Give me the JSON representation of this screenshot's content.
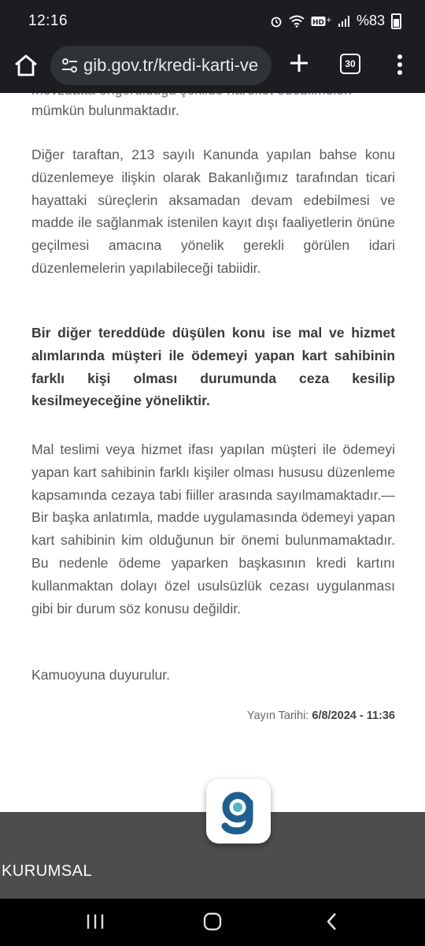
{
  "status_bar": {
    "time": "12:16",
    "battery": "%83"
  },
  "address_bar": {
    "url": "gib.gov.tr/kredi-karti-ve",
    "tab_count": "30"
  },
  "article": {
    "partial_top_line": "mevzuatta öngörüldüğü şekilde hareket edebilmeleri",
    "paragraphs": [
      {
        "text": "mümkün bulunmaktadır.",
        "bold": false
      },
      {
        "text": "Diğer taraftan, 213 sayılı Kanunda yapılan bahse konu düzenlemeye ilişkin olarak Bakanlığımız tarafından ticari hayattaki süreçlerin aksamadan devam edebilmesi ve madde ile sağlanmak istenilen kayıt dışı faaliyetlerin önüne geçilmesi amacına yönelik gerekli görülen idari düzenlemelerin yapılabileceği tabiidir.",
        "bold": false
      },
      {
        "text": "Bir diğer tereddüde düşülen konu ise mal ve hizmet alımlarında müşteri ile ödemeyi yapan kart sahibinin farklı kişi olması durumunda ceza kesilip kesilmeyeceğine yöneliktir.",
        "bold": true
      },
      {
        "text": "Mal teslimi veya hizmet ifası yapılan müşteri ile ödemeyi yapan kart sahibinin farklı kişiler olması hususu düzenleme kapsamında cezaya tabi fiiller arasında sayılmamaktadır.—Bir başka anlatımla, madde uygulamasında ödemeyi yapan kart sahibinin kim olduğunun bir önemi bulunmamaktadır. Bu nedenle ödeme yaparken başkasının kredi kartını kullanmaktan dolayı özel usulsüzlük cezası uygulanması gibi bir durum söz konusu değildir.",
        "bold": false
      },
      {
        "text": "Kamuoyuna duyurulur.",
        "bold": false
      }
    ],
    "publish_label": "Yayın Tarihi:",
    "publish_value": "6/8/2024 - 11:36"
  },
  "footer": {
    "section_label": "KURUMSAL"
  },
  "colors": {
    "status_bg": "#1b1d20",
    "url_pill": "#2f3338",
    "footer_bg": "#4d4d4d",
    "logo_blue": "#1f5f8f"
  },
  "icons": [
    "home-icon",
    "site-settings-icon",
    "new-tab-icon",
    "tab-switcher-icon",
    "more-menu-icon",
    "gib-logo",
    "recent-apps-icon",
    "home-nav-icon",
    "back-icon"
  ]
}
